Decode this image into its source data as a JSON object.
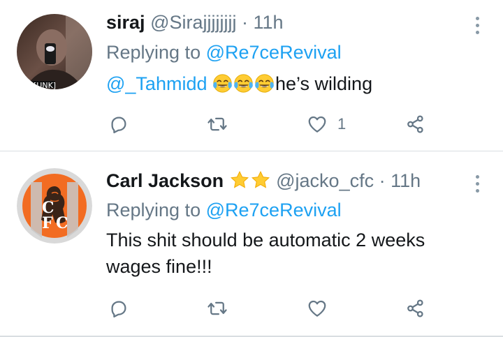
{
  "tweets": [
    {
      "author_name": "siraj",
      "handle": "@Sirajjjjjjjj",
      "separator": "·",
      "time": "11h",
      "replying_prefix": "Replying to",
      "replying_to": "@Re7ceRevival",
      "mention": "@_Tahmidd",
      "emojis": [
        "face-with-tears-of-joy",
        "face-with-tears-of-joy",
        "face-with-tears-of-joy"
      ],
      "text": "he’s wilding",
      "likes": "1",
      "avatar_icon": "profile-photo"
    },
    {
      "author_name": "Carl Jackson",
      "badges": [
        "star",
        "star"
      ],
      "handle": "@jacko_cfc",
      "separator": "·",
      "time": "11h",
      "replying_prefix": "Replying to",
      "replying_to": "@Re7ceRevival",
      "text": "This shit should be automatic 2 weeks wages fine!!!",
      "likes": "",
      "avatar_icon": "cfc-lion-crest",
      "avatar_text": "CFC"
    }
  ],
  "icons": [
    "reply-icon",
    "retweet-icon",
    "like-icon",
    "share-icon",
    "more-icon"
  ],
  "colors": {
    "link": "#1da1f2",
    "secondary": "#657786",
    "icon": "#657786",
    "divider": "#d9dee2",
    "star": "#ffcc33",
    "crest_orange": "#f26c22"
  }
}
